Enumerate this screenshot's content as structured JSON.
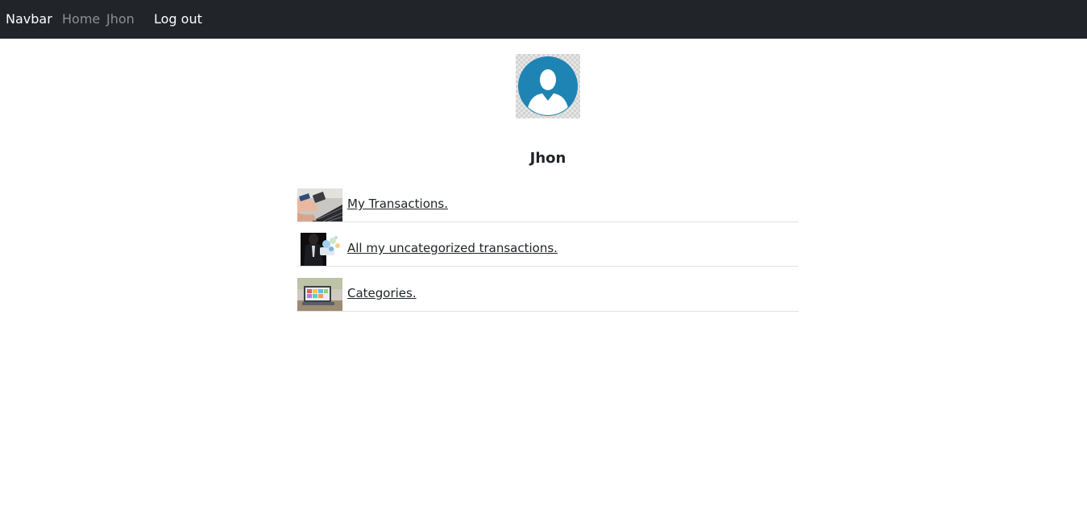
{
  "navbar": {
    "brand": "Navbar",
    "links": [
      "Home",
      "Jhon"
    ],
    "logout": "Log out",
    "background": "#212529"
  },
  "profile": {
    "avatar_icon": "user-avatar-icon",
    "avatar_color": "#1e84b4",
    "name": "Jhon"
  },
  "menu": {
    "items": [
      {
        "label": "My Transactions.",
        "thumbnail": "transactions-thumbnail"
      },
      {
        "label": "All my uncategorized transactions.",
        "thumbnail": "uncategorized-thumbnail"
      },
      {
        "label": "Categories.",
        "thumbnail": "categories-thumbnail"
      }
    ]
  }
}
